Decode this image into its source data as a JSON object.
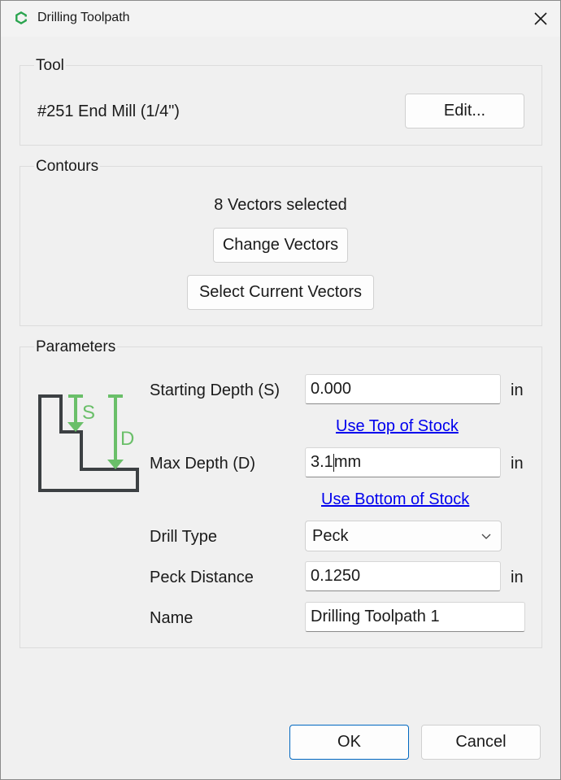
{
  "window": {
    "title": "Drilling Toolpath"
  },
  "tool": {
    "section_title": "Tool",
    "name": "#251 End Mill (1/4\")",
    "edit_label": "Edit..."
  },
  "contours": {
    "section_title": "Contours",
    "status": "8 Vectors selected",
    "change_label": "Change Vectors",
    "select_current_label": "Select Current Vectors"
  },
  "parameters": {
    "section_title": "Parameters",
    "diagram": {
      "s_label": "S",
      "d_label": "D"
    },
    "starting_depth": {
      "label": "Starting Depth (S)",
      "value": "0.000",
      "unit": "in",
      "link": "Use Top of Stock"
    },
    "max_depth": {
      "label": "Max Depth (D)",
      "value_before_caret": "3.1",
      "value_after_caret": "mm",
      "unit": "in",
      "link": "Use Bottom of Stock"
    },
    "drill_type": {
      "label": "Drill Type",
      "value": "Peck"
    },
    "peck_distance": {
      "label": "Peck Distance",
      "value": "0.1250",
      "unit": "in"
    },
    "name": {
      "label": "Name",
      "value": "Drilling Toolpath 1"
    }
  },
  "footer": {
    "ok_label": "OK",
    "cancel_label": "Cancel"
  },
  "colors": {
    "accent_green": "#6abf69",
    "dark_outline": "#3c4043",
    "link_blue": "#0000ee",
    "primary_border": "#0067c0"
  },
  "icons": {
    "app": "app-logo-icon",
    "close": "close-icon",
    "dropdown": "chevron-down-icon"
  }
}
